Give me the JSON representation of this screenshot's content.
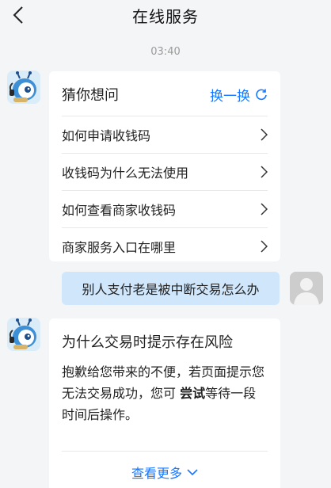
{
  "header": {
    "title": "在线服务"
  },
  "timestamp": "03:40",
  "guess_card": {
    "title": "猜你想问",
    "refresh_label": "换一换",
    "questions": [
      "如何申请收钱码",
      "收钱码为什么无法使用",
      "如何查看商家收钱码",
      "商家服务入口在哪里"
    ]
  },
  "user_message": "别人支付老是被中断交易怎么办",
  "answer_card": {
    "title": "为什么交易时提示存在风险",
    "body_before": "抱歉给您带来的不便，若页面提示您无法交易成功，您可 ",
    "body_bold": "尝试",
    "body_after": "等待一段时间后操作。",
    "more_label": "查看更多"
  },
  "colors": {
    "accent": "#1677ff",
    "user_bubble": "#cfe6fb",
    "background": "#f4f5f7"
  },
  "icons": {
    "back": "chevron-left-icon",
    "refresh": "refresh-icon",
    "question_arrow": "chevron-right-icon",
    "more": "chevron-down-icon",
    "bot": "ant-bot-avatar",
    "user": "default-user-avatar"
  }
}
